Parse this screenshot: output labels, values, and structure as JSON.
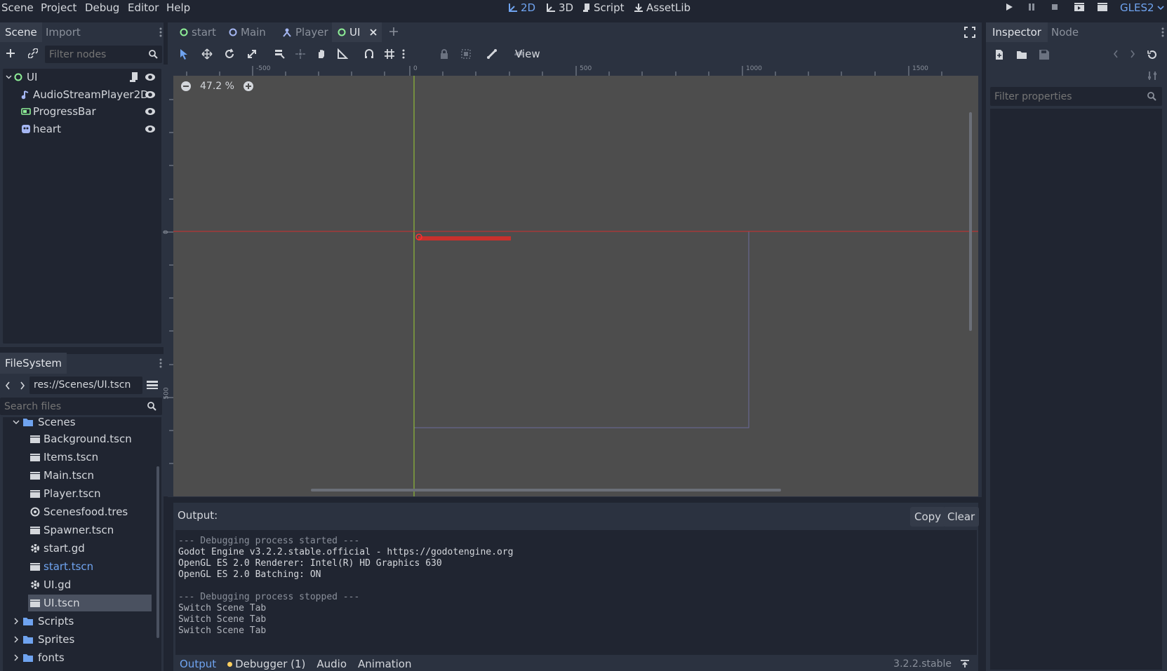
{
  "menu": [
    "Scene",
    "Project",
    "Debug",
    "Editor",
    "Help"
  ],
  "workspaces": {
    "d2": "2D",
    "d3": "3D",
    "script": "Script",
    "assetlib": "AssetLib"
  },
  "renderer": "GLES2",
  "scene_dock": {
    "tabs": [
      "Scene",
      "Import"
    ],
    "filter_placeholder": "Filter nodes",
    "tree": [
      {
        "label": "UI",
        "icon": "control-node-icon"
      },
      {
        "label": "AudioStreamPlayer2D",
        "icon": "audio-node-icon"
      },
      {
        "label": "ProgressBar",
        "icon": "progressbar-node-icon"
      },
      {
        "label": "heart",
        "icon": "sprite-node-icon"
      }
    ]
  },
  "filesystem": {
    "title": "FileSystem",
    "path": "res://Scenes/UI.tscn",
    "search_placeholder": "Search files",
    "items": [
      {
        "label": "Scenes",
        "type": "folder"
      },
      {
        "label": "Background.tscn",
        "type": "scene"
      },
      {
        "label": "Items.tscn",
        "type": "scene"
      },
      {
        "label": "Main.tscn",
        "type": "scene"
      },
      {
        "label": "Player.tscn",
        "type": "scene"
      },
      {
        "label": "Scenesfood.tres",
        "type": "resource"
      },
      {
        "label": "Spawner.tscn",
        "type": "scene"
      },
      {
        "label": "start.gd",
        "type": "script"
      },
      {
        "label": "start.tscn",
        "type": "scene"
      },
      {
        "label": "UI.gd",
        "type": "script"
      },
      {
        "label": "UI.tscn",
        "type": "scene"
      },
      {
        "label": "Scripts",
        "type": "folder"
      },
      {
        "label": "Sprites",
        "type": "folder"
      },
      {
        "label": "fonts",
        "type": "folder"
      }
    ],
    "highlight_color": "#6fa3ef"
  },
  "scene_tabs": [
    "start",
    "Main",
    "Player",
    "UI"
  ],
  "toolbar": {
    "view": "View"
  },
  "viewport": {
    "zoom": "47.2 %",
    "ruler_h": [
      "-500",
      "0",
      "500",
      "1000",
      "1500"
    ],
    "ruler_v": [
      "0",
      "500"
    ],
    "bg_color": "#4d4d4d",
    "progress_color": "#c9302c"
  },
  "inspector": {
    "tabs": [
      "Inspector",
      "Node"
    ],
    "filter_placeholder": "Filter properties"
  },
  "output": {
    "title": "Output:",
    "copy": "Copy",
    "clear": "Clear",
    "lines": [
      "--- Debugging process started ---",
      "Godot Engine v3.2.2.stable.official - https://godotengine.org",
      "OpenGL ES 2.0 Renderer: Intel(R) HD Graphics 630",
      "OpenGL ES 2.0 Batching: ON",
      "",
      "--- Debugging process stopped ---",
      "Switch Scene Tab",
      "Switch Scene Tab",
      "Switch Scene Tab"
    ],
    "bottom_tabs": [
      "Output",
      "Debugger (1)",
      "Audio",
      "Animation"
    ],
    "version": "3.2.2.stable"
  }
}
